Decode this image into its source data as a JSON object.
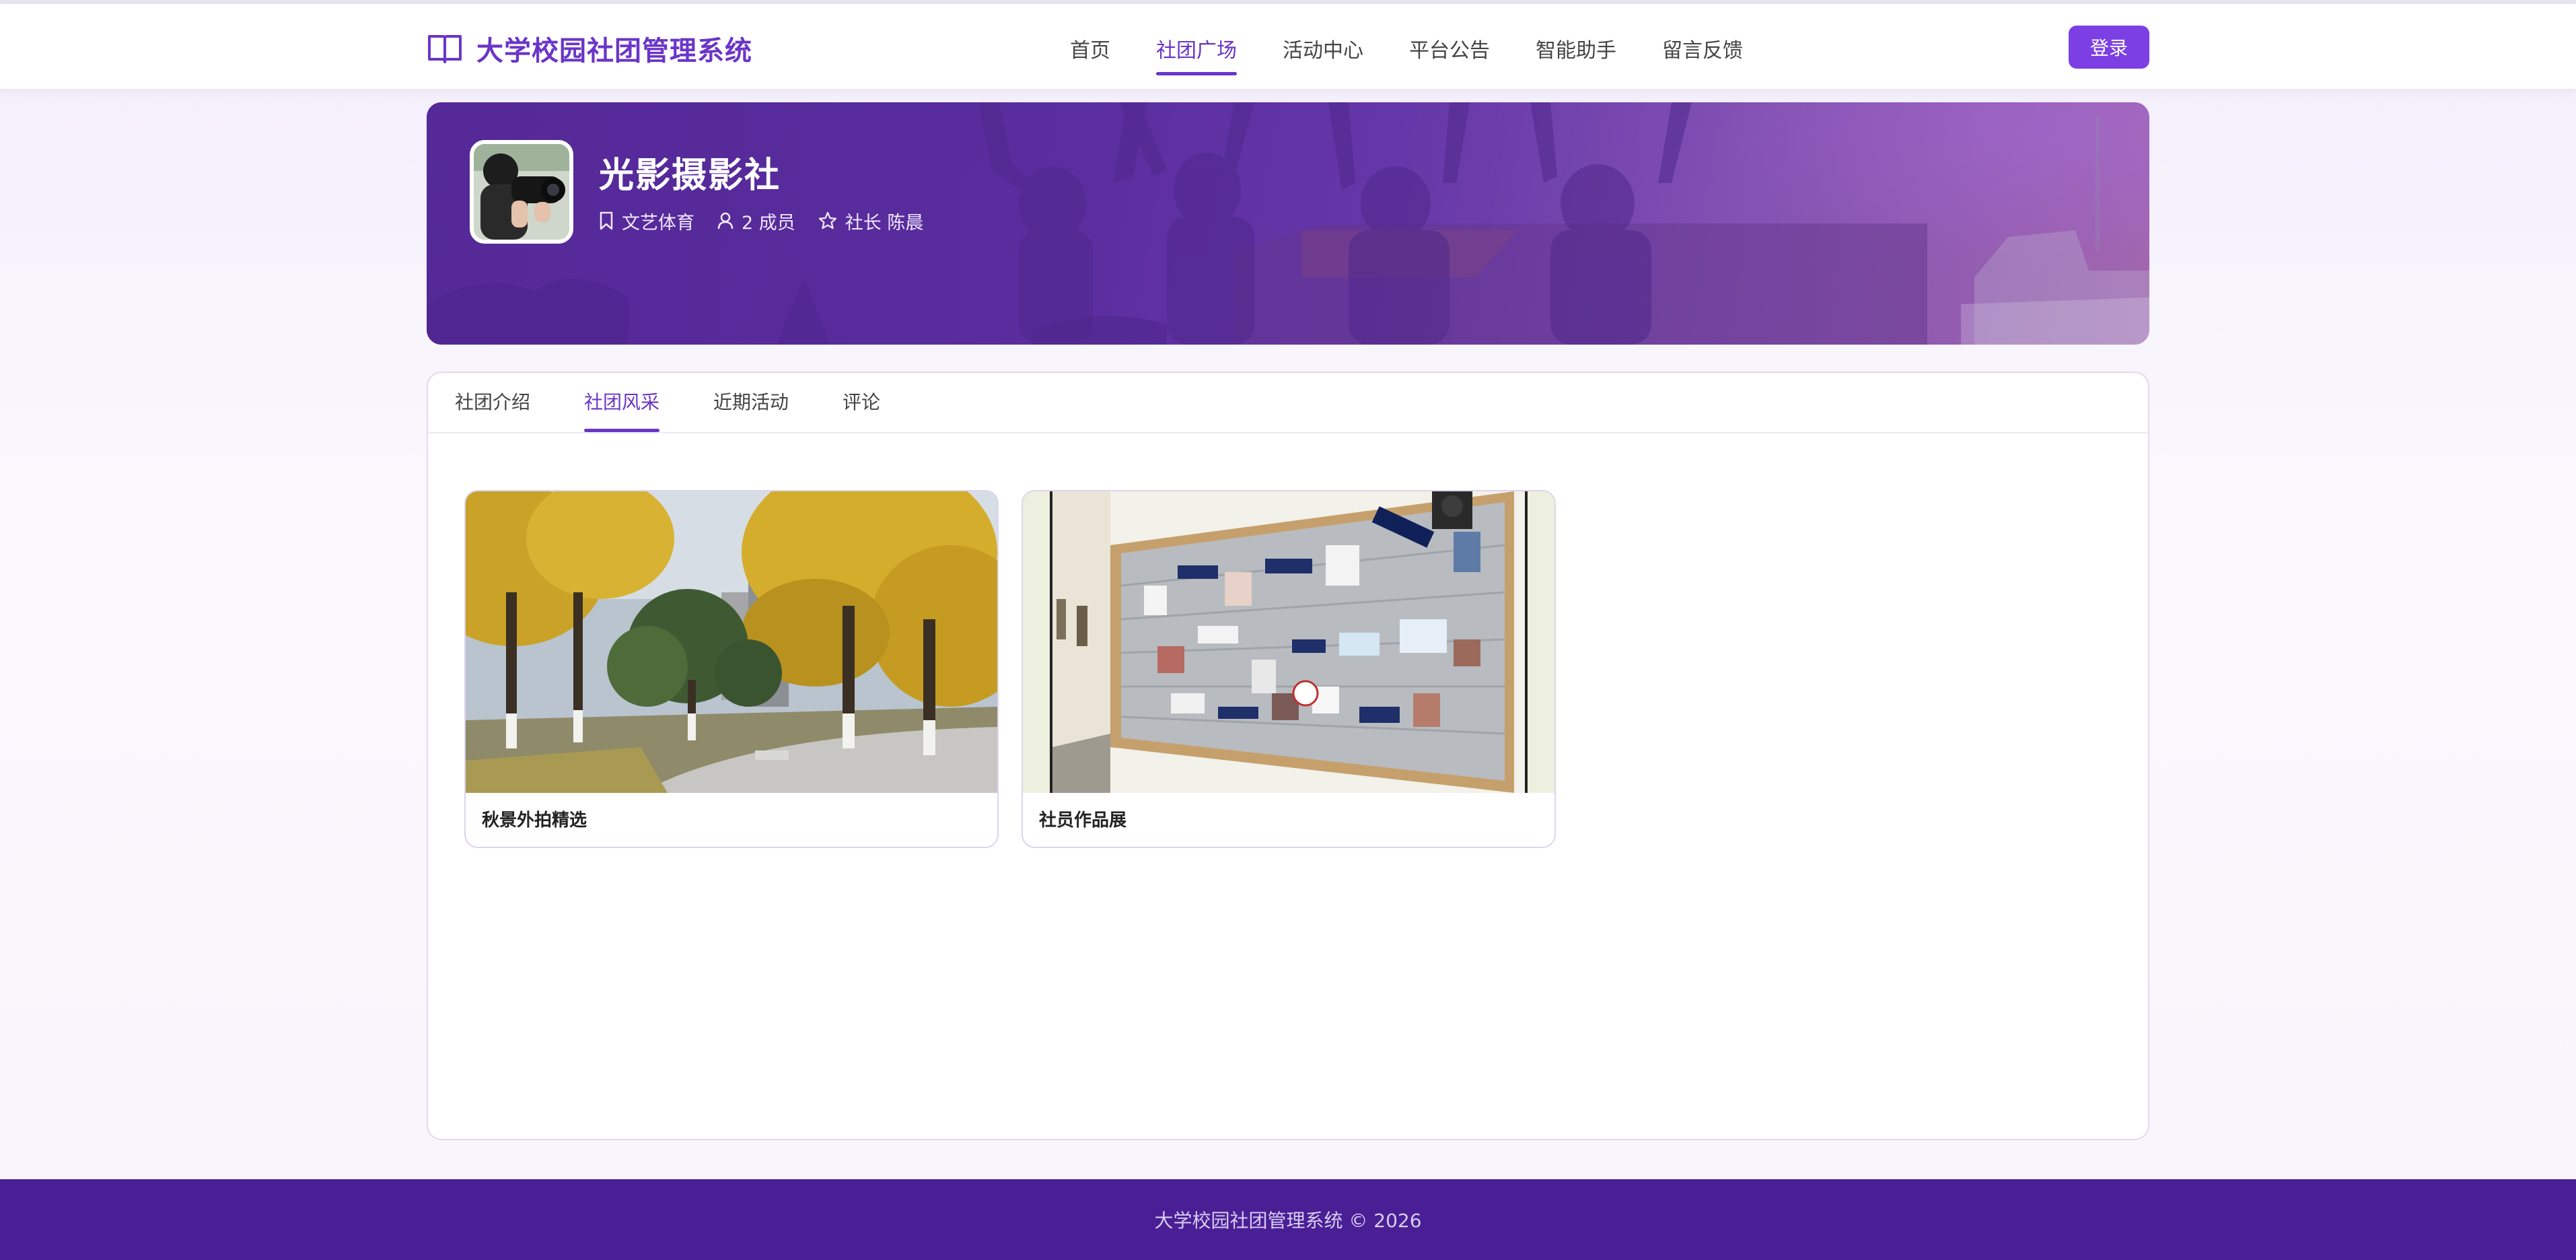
{
  "header": {
    "brand_icon": "open-book-icon",
    "brand_title": "大学校园社团管理系统",
    "nav": [
      {
        "label": "首页"
      },
      {
        "label": "社团广场",
        "active": true
      },
      {
        "label": "活动中心"
      },
      {
        "label": "平台公告"
      },
      {
        "label": "智能助手"
      },
      {
        "label": "留言反馈"
      }
    ],
    "login_label": "登录"
  },
  "club": {
    "name": "光影摄影社",
    "category_icon": "bookmark-icon",
    "category": "文艺体育",
    "members_icon": "user-icon",
    "members": "2 成员",
    "leader_icon": "star-icon",
    "leader": "社长 陈晨"
  },
  "tabs": [
    {
      "label": "社团介绍"
    },
    {
      "label": "社团风采",
      "active": true
    },
    {
      "label": "近期活动"
    },
    {
      "label": "评论"
    }
  ],
  "gallery": [
    {
      "caption": "秋景外拍精选"
    },
    {
      "caption": "社员作品展"
    }
  ],
  "footer": {
    "text": "大学校园社团管理系统 © 2026"
  },
  "colors": {
    "accent": "#6a35c8",
    "button": "#7b3fe4",
    "footer_bg": "#4a1f95"
  }
}
